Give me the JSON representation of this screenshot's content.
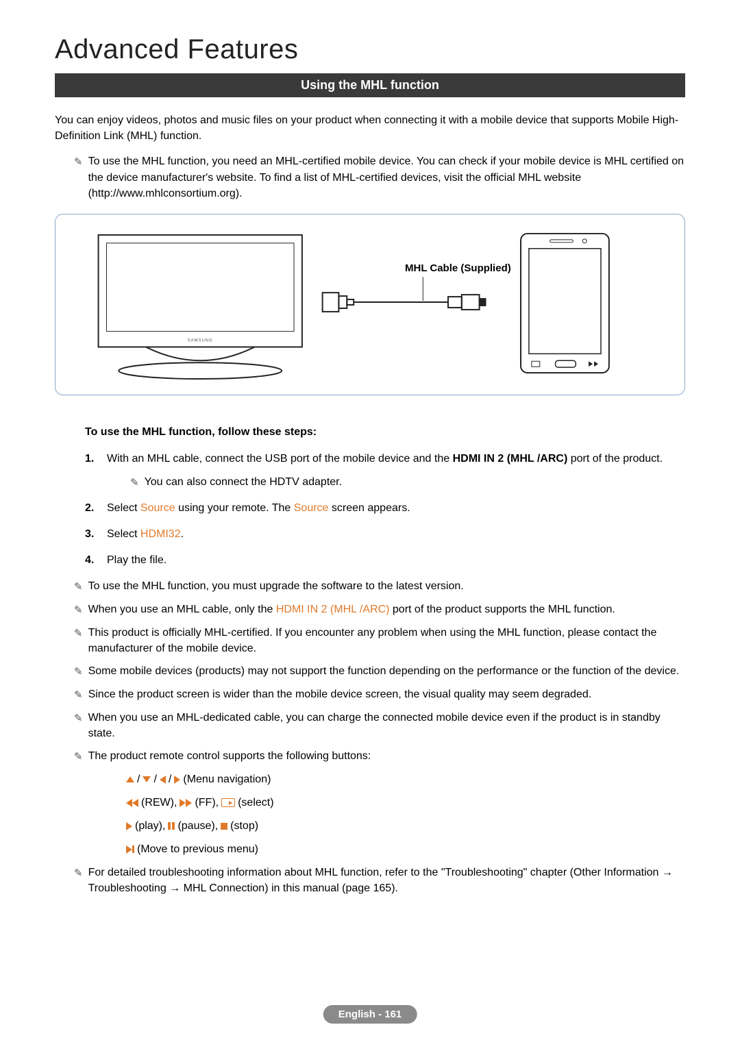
{
  "chapter_title": "Advanced Features",
  "section_title": "Using the MHL function",
  "intro": "You can enjoy videos, photos and music files on your product when connecting it with a mobile device that supports Mobile High-Definition Link (MHL) function.",
  "top_note": "To use the MHL function, you need an MHL-certified mobile device. You can check if your mobile device is MHL certified on the device manufacturer's website. To find a list of MHL-certified devices, visit the official MHL website (http://www.mhlconsortium.org).",
  "diagram": {
    "cable_label": "MHL Cable (Supplied)",
    "tv_brand": "SAMSUNG"
  },
  "steps_heading": "To use the MHL function, follow these steps:",
  "steps": [
    {
      "num": "1.",
      "pre": "With an MHL cable, connect the USB port of the mobile device and the ",
      "bold": "HDMI IN 2 (MHL /ARC)",
      "post": " port of the product.",
      "sub_note": "You can also connect the HDTV adapter."
    },
    {
      "num": "2.",
      "pre": "Select ",
      "kw1": "Source",
      "mid": " using your remote. The ",
      "kw2": "Source",
      "post": " screen appears."
    },
    {
      "num": "3.",
      "pre": "Select ",
      "kw1": "HDMI32",
      "post": "."
    },
    {
      "num": "4.",
      "pre": "Play the file."
    }
  ],
  "notes": [
    {
      "text": "To use the MHL function, you must upgrade the software to the latest version."
    },
    {
      "pre": "When you use an MHL cable, only the ",
      "kw": "HDMI IN 2 (MHL /ARC)",
      "post": " port of the product supports the MHL function."
    },
    {
      "text": "This product is officially MHL-certified. If you encounter any problem when using the MHL function, please contact the manufacturer of the mobile device."
    },
    {
      "text": "Some mobile devices (products) may not support the function depending on the performance or the function of the device."
    },
    {
      "text": "Since the product screen is wider than the mobile device screen, the visual quality may seem degraded."
    },
    {
      "text": "When you use an MHL-dedicated cable, you can charge the connected mobile device even if the product is in standby state."
    },
    {
      "text": "The product remote control supports the following buttons:"
    }
  ],
  "remote": {
    "nav_label": " (Menu navigation)",
    "rew": " (REW), ",
    "ff": " (FF), ",
    "select": " (select)",
    "play": " (play), ",
    "pause": " (pause), ",
    "stop": " (stop)",
    "back": " (Move to previous menu)"
  },
  "final_note": "For detailed troubleshooting information about MHL function, refer to the \"Troubleshooting\" chapter (Other Information → Troubleshooting → MHL Connection) in this manual (page 165).",
  "footer": "English - 161",
  "sep": " / "
}
